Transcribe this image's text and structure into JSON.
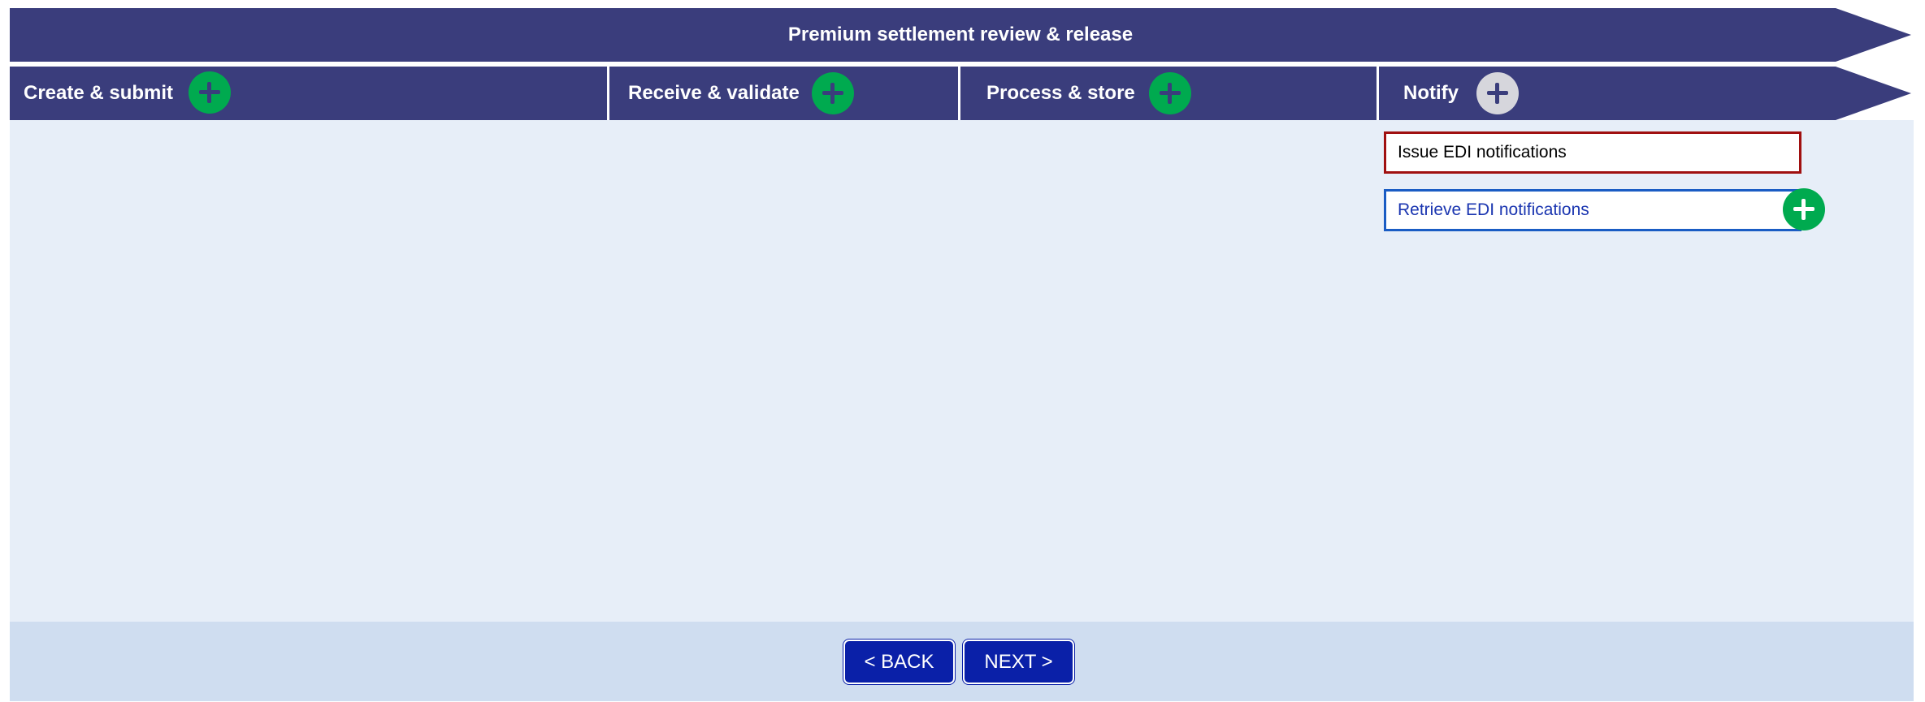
{
  "banner": {
    "title": "Premium settlement review & release"
  },
  "stages": [
    {
      "label": "Create & submit",
      "icon": "plus-icon",
      "icon_color": "#00aa4f"
    },
    {
      "label": "Receive & validate",
      "icon": "plus-icon",
      "icon_color": "#00aa4f"
    },
    {
      "label": "Process & store",
      "icon": "plus-icon",
      "icon_color": "#00aa4f"
    },
    {
      "label": "Notify",
      "icon": "plus-icon",
      "icon_color": "#d6d6dc"
    }
  ],
  "notify_items": [
    {
      "label": "Issue EDI notifications",
      "border_color": "#a01010"
    },
    {
      "label": "Retrieve EDI notifications",
      "border_color": "#1a5cc4",
      "icon": "plus-icon"
    }
  ],
  "navigation": {
    "back_label": "< BACK",
    "next_label": "NEXT >"
  },
  "colors": {
    "banner": "#3a3d7c",
    "content_bg": "#e7eef8",
    "footer_bg": "#cfddf0",
    "nav_button": "#0a20a8",
    "accent_green": "#00aa4f"
  }
}
